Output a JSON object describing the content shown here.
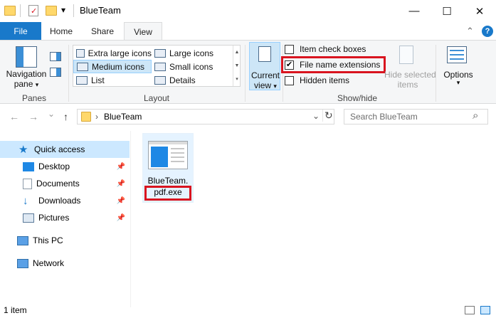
{
  "window": {
    "title": "BlueTeam",
    "minimize_glyph": "—",
    "maximize_glyph": "☐",
    "close_glyph": "✕",
    "qa_dropdown_glyph": "▾"
  },
  "tabs": {
    "file": "File",
    "home": "Home",
    "share": "Share",
    "view": "View"
  },
  "ribbon_controls": {
    "collapse_glyph": "⌃",
    "help_glyph": "?"
  },
  "panes": {
    "navigation_pane_line1": "Navigation",
    "navigation_pane_line2": "pane",
    "dropdown_glyph": "▾",
    "group_label": "Panes"
  },
  "layout": {
    "options": [
      {
        "label": "Extra large icons",
        "selected": false
      },
      {
        "label": "Large icons",
        "selected": false
      },
      {
        "label": "Medium icons",
        "selected": true
      },
      {
        "label": "Small icons",
        "selected": false
      },
      {
        "label": "List",
        "selected": false
      },
      {
        "label": "Details",
        "selected": false
      }
    ],
    "group_label": "Layout"
  },
  "current_view": {
    "line1": "Current",
    "line2": "view",
    "dropdown_glyph": "▾"
  },
  "show_hide": {
    "item_check_boxes": {
      "label": "Item check boxes",
      "checked": false
    },
    "file_name_extensions": {
      "label": "File name extensions",
      "checked": true
    },
    "hidden_items": {
      "label": "Hidden items",
      "checked": false
    },
    "hide_selected_line1": "Hide selected",
    "hide_selected_line2": "items",
    "group_label": "Show/hide",
    "check_glyph": "✔"
  },
  "options": {
    "label": "Options",
    "dropdown_glyph": "▾"
  },
  "address_bar": {
    "back_glyph": "←",
    "forward_glyph": "→",
    "recent_glyph": "⌄",
    "up_glyph": "↑",
    "separator_glyph": "›",
    "path": "BlueTeam",
    "refresh_glyph": "↻",
    "search_placeholder": "Search BlueTeam",
    "search_glyph": "⌕"
  },
  "sidebar": {
    "pin_glyph": "📌",
    "items": [
      {
        "label": "Quick access",
        "pinned": false,
        "selected": true
      },
      {
        "label": "Desktop",
        "pinned": true
      },
      {
        "label": "Documents",
        "pinned": true
      },
      {
        "label": "Downloads",
        "pinned": true
      },
      {
        "label": "Pictures",
        "pinned": true
      },
      {
        "label": "This PC",
        "pinned": false
      },
      {
        "label": "Network",
        "pinned": false
      }
    ]
  },
  "file": {
    "name_line1": "BlueTeam.",
    "name_line2": "pdf.exe"
  },
  "status_bar": {
    "item_count": "1 item"
  },
  "colors": {
    "accent": "#1979ca",
    "highlight_red": "#d9141f",
    "selection": "#cce8ff"
  }
}
